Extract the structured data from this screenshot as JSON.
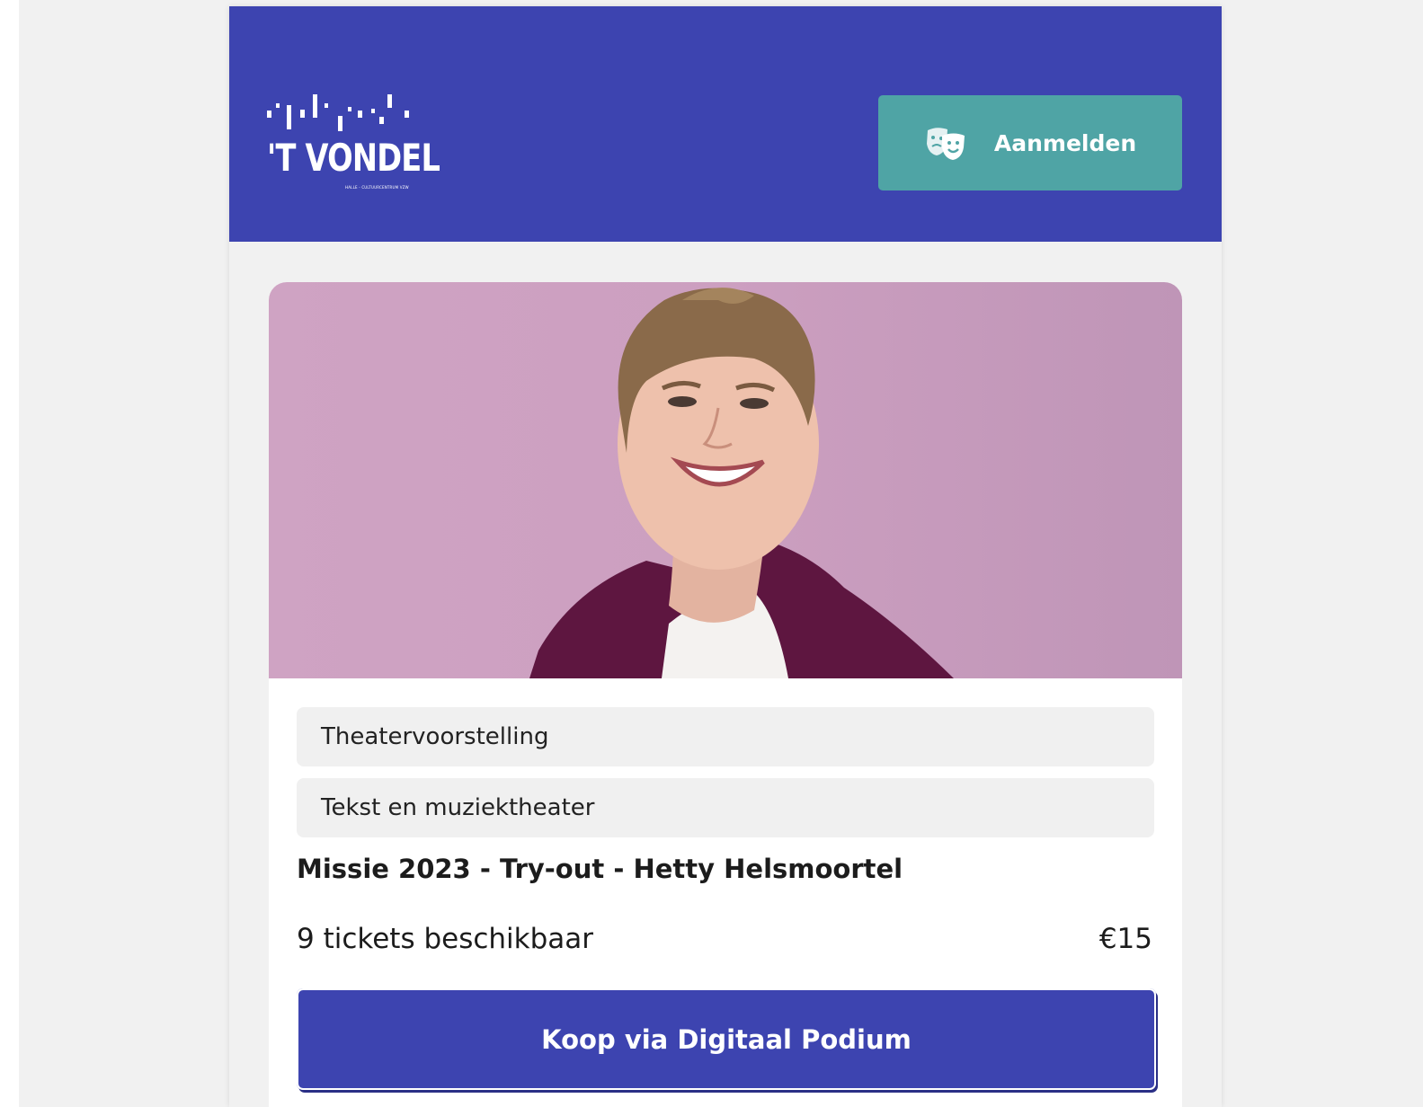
{
  "brand": {
    "logo_text": "'T VONDEL",
    "logo_subtext": "HALLE - CULTUURCENTRUM VZW",
    "header_color": "#3d44b0"
  },
  "header": {
    "login_label": "Aanmelden",
    "login_icon": "theater-masks-icon",
    "login_color": "#4fa4a5"
  },
  "event": {
    "image": "performer-portrait",
    "tags": [
      "Theatervoorstelling",
      "Tekst en muziektheater"
    ],
    "title": "Missie 2023 - Try-out - Hetty Helsmoortel",
    "availability": "9 tickets beschikbaar",
    "price": "€15",
    "buy_label": "Koop via Digitaal Podium"
  }
}
